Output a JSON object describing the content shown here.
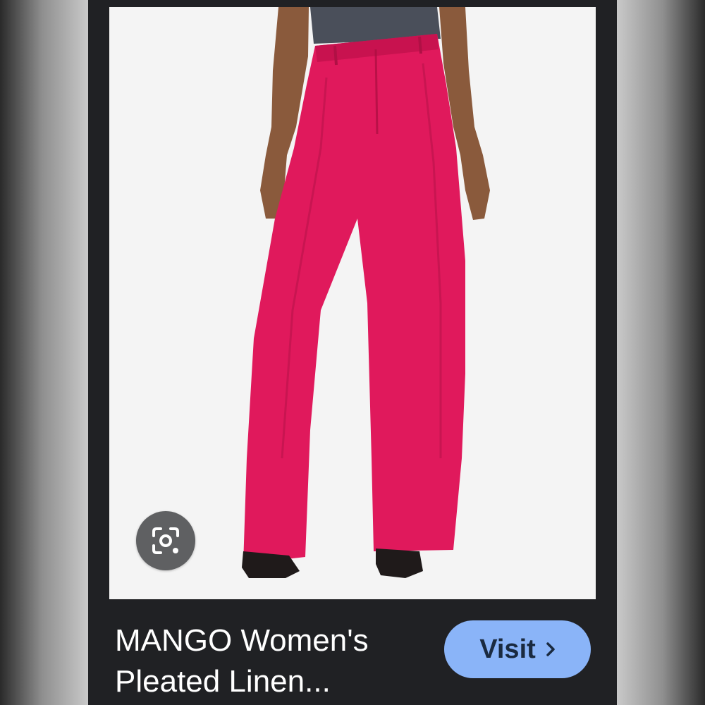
{
  "product": {
    "title": "MANGO Women's\nPleated Linen..."
  },
  "actions": {
    "visit_label": "Visit",
    "visit_icon": "chevron-right-icon",
    "lens_icon": "google-lens-icon"
  },
  "image": {
    "subject": "pleated linen trousers",
    "colors": {
      "trousers": "#e0195c",
      "top": "#4a4f5a",
      "skin": "#8a5a3c",
      "shoes": "#1f1a1a",
      "background": "#f4f4f4"
    }
  },
  "theme": {
    "panel_bg": "#202124",
    "accent": "#8ab4f8",
    "lens_bg": "#5f6062"
  }
}
